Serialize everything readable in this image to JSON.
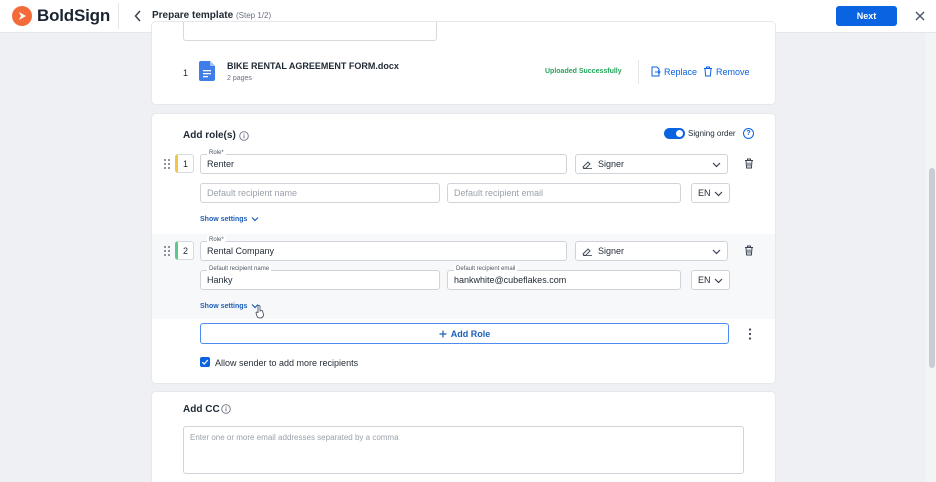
{
  "app": {
    "brand_name": "BoldSign",
    "brand_color": "#f26b38",
    "accent": "#0a63e0"
  },
  "header": {
    "title": "Prepare template",
    "step": "(Step 1/2)",
    "next_label": "Next",
    "back_icon": "chevron-left-icon",
    "close_icon": "close-icon"
  },
  "file": {
    "index": "1",
    "name": "BIKE RENTAL AGREEMENT FORM.docx",
    "pages": "2 pages",
    "status": "Uploaded Successfully",
    "replace_label": "Replace",
    "remove_label": "Remove"
  },
  "roles_section": {
    "title": "Add role(s)",
    "signing_order_label": "Signing order",
    "signing_order_on": true,
    "help_glyph": "?",
    "role_label": "Role*",
    "name_label": "Default recipient name",
    "email_label": "Default recipient email",
    "name_placeholder": "Default recipient name",
    "email_placeholder": "Default recipient email",
    "show_settings_label": "Show settings",
    "roles": [
      {
        "number": "1",
        "role": "Renter",
        "type": "Signer",
        "name": "",
        "email": "",
        "lang": "EN"
      },
      {
        "number": "2",
        "role": "Rental Company",
        "type": "Signer",
        "name": "Hanky",
        "email": "hankwhite@cubeflakes.com",
        "lang": "EN"
      }
    ],
    "add_role_label": "Add Role",
    "allow_more_label": "Allow sender to add more recipients",
    "allow_more_checked": true
  },
  "cc_section": {
    "title": "Add CC",
    "placeholder": "Enter one or more email addresses separated by a comma"
  }
}
